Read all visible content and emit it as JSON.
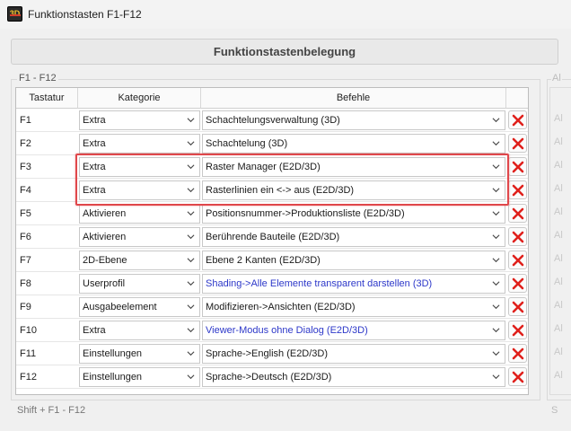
{
  "window": {
    "title": "Funktionstasten F1-F12"
  },
  "heading": "Funktionstastenbelegung",
  "group_left": {
    "label": "F1 - F12"
  },
  "group_right": {
    "label": "Al"
  },
  "columns": {
    "key": "Tastatur",
    "category": "Kategorie",
    "command": "Befehle"
  },
  "rows": [
    {
      "key": "F1",
      "category": "Extra",
      "command": "Schachtelungsverwaltung (3D)",
      "command_color": "#1a1a1a"
    },
    {
      "key": "F2",
      "category": "Extra",
      "command": "Schachtelung (3D)",
      "command_color": "#1a1a1a"
    },
    {
      "key": "F3",
      "category": "Extra",
      "command": "Raster Manager (E2D/3D)",
      "command_color": "#1a1a1a"
    },
    {
      "key": "F4",
      "category": "Extra",
      "command": "Rasterlinien ein <-> aus (E2D/3D)",
      "command_color": "#1a1a1a"
    },
    {
      "key": "F5",
      "category": "Aktivieren",
      "command": "Positionsnummer->Produktionsliste (E2D/3D)",
      "command_color": "#1a1a1a"
    },
    {
      "key": "F6",
      "category": "Aktivieren",
      "command": "Berührende Bauteile (E2D/3D)",
      "command_color": "#1a1a1a"
    },
    {
      "key": "F7",
      "category": "2D-Ebene",
      "command": "Ebene 2 Kanten (E2D/3D)",
      "command_color": "#1a1a1a"
    },
    {
      "key": "F8",
      "category": "Userprofil",
      "command": "Shading->Alle Elemente transparent darstellen (3D)",
      "command_color": "#2d38c9"
    },
    {
      "key": "F9",
      "category": "Ausgabeelement",
      "command": "Modifizieren->Ansichten (E2D/3D)",
      "command_color": "#1a1a1a"
    },
    {
      "key": "F10",
      "category": "Extra",
      "command": "Viewer-Modus ohne Dialog (E2D/3D)",
      "command_color": "#2d38c9"
    },
    {
      "key": "F11",
      "category": "Einstellungen",
      "command": "Sprache->English (E2D/3D)",
      "command_color": "#1a1a1a"
    },
    {
      "key": "F12",
      "category": "Einstellungen",
      "command": "Sprache->Deutsch (E2D/3D)",
      "command_color": "#1a1a1a"
    }
  ],
  "right_column_labels": [
    "Al",
    "Al",
    "Al",
    "Al",
    "Al",
    "Al",
    "Al",
    "Al",
    "Al",
    "Al",
    "Al",
    "Al"
  ],
  "bottom_label": "Shift + F1 - F12",
  "bottom_right_label": "S",
  "icons": {
    "delete": "delete-x-icon",
    "dropdown": "chevron-down-icon"
  },
  "colors": {
    "delete_red": "#e0201b",
    "highlight": "#e0474b",
    "link_blue": "#2d38c9"
  }
}
